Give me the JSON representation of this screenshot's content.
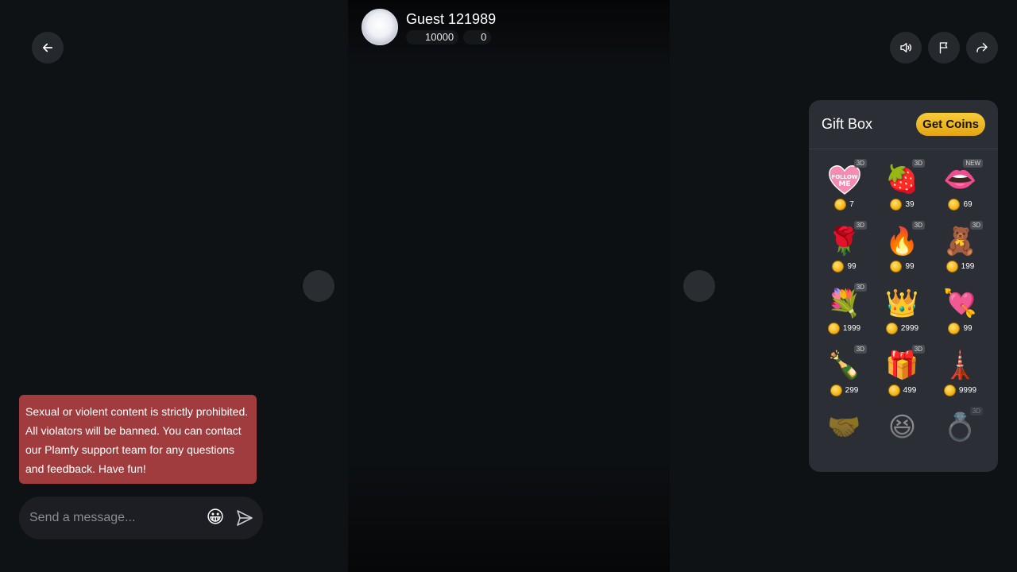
{
  "profile": {
    "name": "Guest 121989",
    "coins": "10000",
    "points": "0"
  },
  "giftbox": {
    "title": "Gift Box",
    "get_coins_label": "Get Coins",
    "gifts": [
      {
        "name": "follow-me-heart",
        "price": "7",
        "tag": "3D"
      },
      {
        "name": "strawberry",
        "price": "39",
        "tag": "3D"
      },
      {
        "name": "lips",
        "price": "69",
        "tag": "NEW"
      },
      {
        "name": "rose",
        "price": "99",
        "tag": "3D"
      },
      {
        "name": "fire",
        "price": "99",
        "tag": "3D"
      },
      {
        "name": "teddy-bear",
        "price": "199",
        "tag": "3D"
      },
      {
        "name": "rose-bouquet",
        "price": "1999",
        "tag": "3D"
      },
      {
        "name": "tiara",
        "price": "2999",
        "tag": ""
      },
      {
        "name": "heart-arrow",
        "price": "99",
        "tag": ""
      },
      {
        "name": "champagne",
        "price": "299",
        "tag": "3D"
      },
      {
        "name": "chocolate-box",
        "price": "499",
        "tag": "3D"
      },
      {
        "name": "eiffel-tower",
        "price": "9999",
        "tag": ""
      },
      {
        "name": "hand",
        "price": "",
        "tag": ""
      },
      {
        "name": "laughing-face",
        "price": "",
        "tag": ""
      },
      {
        "name": "diamond-ring",
        "price": "",
        "tag": "3D"
      }
    ]
  },
  "notice": {
    "text": "Sexual or violent content is strictly prohibited. All violators will be banned. You can contact our Plamfy support team for any questions and feedback. Have fun!"
  },
  "chat": {
    "placeholder": "Send a message..."
  },
  "icons": {
    "back": "arrow-left-icon",
    "sound": "speaker-icon",
    "report": "flag-icon",
    "share": "share-icon",
    "emoji": "grinning-face-icon",
    "send": "send-icon",
    "coin": "coin-icon"
  },
  "colors": {
    "accent": "#f4b517",
    "notice_bg": "#a03c3e",
    "panel_bg": "#2b2e34"
  }
}
